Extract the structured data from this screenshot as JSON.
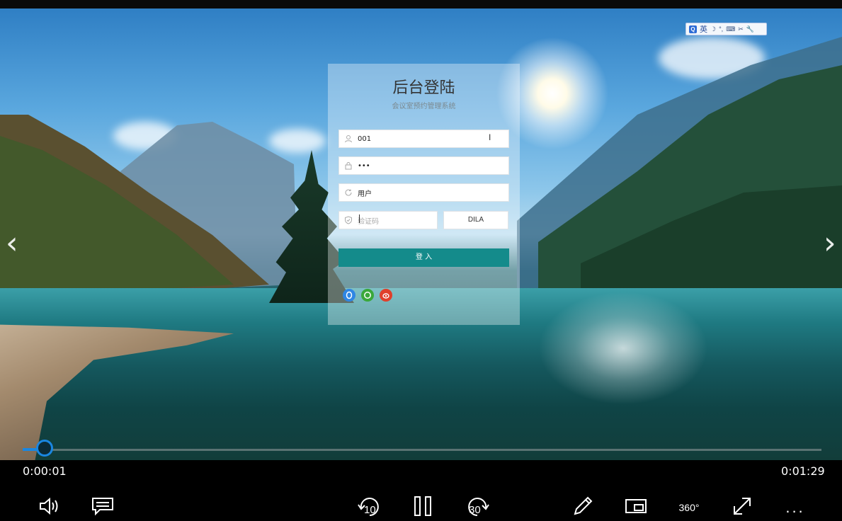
{
  "login": {
    "title": "后台登陆",
    "subtitle": "会议室预约管理系统",
    "username_value": "001",
    "password_value": "•••",
    "role_value": "用户",
    "captcha_placeholder": "验证码",
    "captcha_code": "DILA",
    "submit_label": "登 入"
  },
  "ime": {
    "lang": "英",
    "symbols": [
      "☽",
      "°,",
      "⌨",
      "✂",
      "🔧"
    ]
  },
  "player": {
    "current_time": "0:00:01",
    "total_time": "0:01:29",
    "progress_fraction": 0.011,
    "rewind_seconds": "10",
    "forward_seconds": "30",
    "vr_label": "360°",
    "more_label": "..."
  },
  "colors": {
    "accent": "#148b8b",
    "progress": "#1a86e0"
  },
  "icons": {
    "social": [
      "qq-icon",
      "wechat-icon",
      "weibo-icon"
    ]
  }
}
